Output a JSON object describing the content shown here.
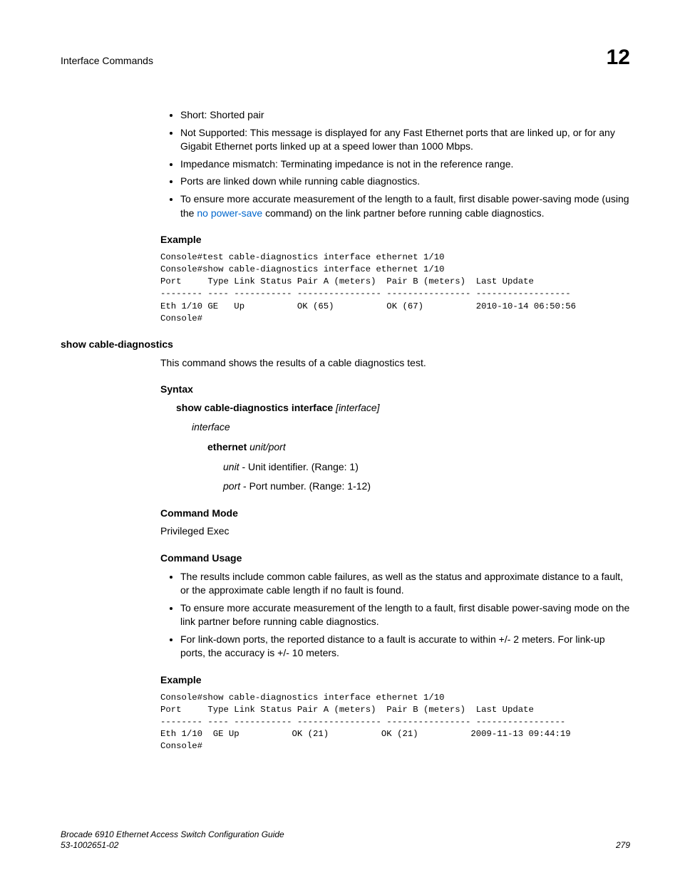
{
  "header": {
    "title": "Interface Commands",
    "chapter": "12"
  },
  "top_bullets_inner": [
    "Short: Shorted pair",
    "Not Supported: This message is displayed for any Fast Ethernet ports that are linked up, or for any Gigabit Ethernet ports linked up at a speed lower than 1000 Mbps.",
    "Impedance mismatch: Terminating impedance is not in the reference range."
  ],
  "top_bullets_outer": {
    "b1": "Ports are linked down while running cable diagnostics.",
    "b2_pre": "To ensure more accurate measurement of the length to a fault, first disable power-saving mode (using the ",
    "b2_link": "no power-save",
    "b2_post": " command) on the link partner before running cable diagnostics."
  },
  "example1": {
    "heading": "Example",
    "code": "Console#test cable-diagnostics interface ethernet 1/10\nConsole#show cable-diagnostics interface ethernet 1/10\nPort     Type Link Status Pair A (meters)  Pair B (meters)  Last Update\n-------- ---- ----------- ---------------- ---------------- ------------------\nEth 1/10 GE   Up          OK (65)          OK (67)          2010-10-14 06:50:56\nConsole#"
  },
  "command": {
    "name_heading": "show cable-diagnostics",
    "description": "This command shows the results of a cable diagnostics test.",
    "syntax": {
      "heading": "Syntax",
      "line1_bold": "show cable-diagnostics interface",
      "line1_italic": " [interface]",
      "interface_label": "interface",
      "ethernet_bold": "ethernet ",
      "ethernet_italic": "unit/port",
      "unit_italic": "unit",
      "unit_rest": " - Unit identifier. (Range: 1)",
      "port_italic": "port",
      "port_rest": " - Port number. (Range: 1-12)"
    },
    "mode": {
      "heading": "Command Mode",
      "text": "Privileged Exec"
    },
    "usage": {
      "heading": "Command Usage",
      "bullets": [
        "The results include common cable failures, as well as the status and approximate distance to a fault, or the approximate cable length if no fault is found.",
        "To ensure more accurate measurement of the length to a fault, first disable power-saving mode on the link partner before running cable diagnostics.",
        "For link-down ports, the reported distance to a fault is accurate to within +/- 2 meters. For link-up ports, the accuracy is +/- 10 meters."
      ]
    }
  },
  "example2": {
    "heading": "Example",
    "code": "Console#show cable-diagnostics interface ethernet 1/10\nPort     Type Link Status Pair A (meters)  Pair B (meters)  Last Update\n-------- ---- ----------- ---------------- ---------------- -----------------\nEth 1/10  GE Up          OK (21)          OK (21)          2009-11-13 09:44:19\nConsole#"
  },
  "footer": {
    "line1": "Brocade 6910 Ethernet Access Switch Configuration Guide",
    "line2": "53-1002651-02",
    "page": "279"
  }
}
